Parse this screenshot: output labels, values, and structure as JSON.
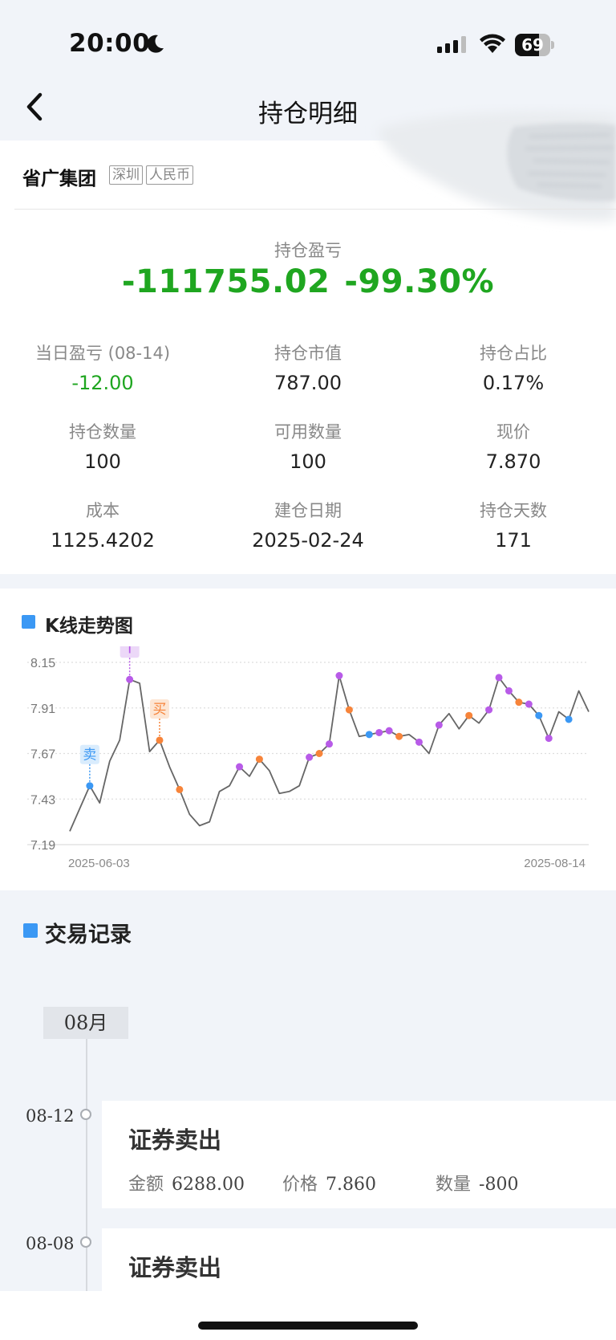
{
  "status_bar": {
    "time": "20:00",
    "battery_level": 69,
    "battery_text": "69",
    "icons": [
      "moon-icon",
      "cellular-signal-icon",
      "wifi-icon",
      "battery-icon"
    ]
  },
  "nav": {
    "title": "持仓明细",
    "back_icon": "chevron-left-icon"
  },
  "stock": {
    "name": "省广集团",
    "tags": [
      "深圳",
      "人民币"
    ]
  },
  "pnl": {
    "label": "持仓盈亏",
    "amount": "-111755.02",
    "percent": "-99.30%"
  },
  "stats": [
    {
      "label": "当日盈亏 (08-14)",
      "value": "-12.00"
    },
    {
      "label": "持仓市值",
      "value": "787.00"
    },
    {
      "label": "持仓占比",
      "value": "0.17%"
    },
    {
      "label": "持仓数量",
      "value": "100"
    },
    {
      "label": "可用数量",
      "value": "100"
    },
    {
      "label": "现价",
      "value": "7.870"
    },
    {
      "label": "成本",
      "value": "1125.4202"
    },
    {
      "label": "建仓日期",
      "value": "2025-02-24"
    },
    {
      "label": "持仓天数",
      "value": "171"
    }
  ],
  "colors": {
    "loss_green": "#1fa620",
    "accent_blue": "#3b98f4",
    "sell_marker": "#3b98f4",
    "buy_marker": "#f7843a",
    "t_marker": "#b85be8",
    "line": "#666666"
  },
  "chart": {
    "title": "K线走势图"
  },
  "chart_data": {
    "type": "line",
    "title": "K线走势图",
    "y_ticks": [
      "8.15",
      "7.91",
      "7.67",
      "7.43",
      "7.19"
    ],
    "ylim": [
      7.19,
      8.15
    ],
    "x_start_label": "2025-06-03",
    "x_end_label": "2025-08-14",
    "grid": true,
    "series": [
      {
        "values": [
          7.26,
          7.38,
          7.5,
          7.41,
          7.63,
          7.74,
          8.06,
          8.04,
          7.68,
          7.74,
          7.6,
          7.48,
          7.35,
          7.29,
          7.31,
          7.47,
          7.5,
          7.6,
          7.55,
          7.64,
          7.58,
          7.46,
          7.47,
          7.5,
          7.65,
          7.67,
          7.72,
          8.08,
          7.9,
          7.76,
          7.77,
          7.78,
          7.79,
          7.76,
          7.77,
          7.73,
          7.67,
          7.82,
          7.88,
          7.8,
          7.87,
          7.83,
          7.9,
          8.07,
          8.0,
          7.94,
          7.93,
          7.87,
          7.75,
          7.89,
          7.85,
          8.0,
          7.89
        ]
      }
    ],
    "markers": [
      {
        "index": 2,
        "type": "sell",
        "label": "卖"
      },
      {
        "index": 6,
        "type": "T",
        "label": "T"
      },
      {
        "index": 9,
        "type": "buy",
        "label": "买"
      },
      {
        "index": 11,
        "type": "buy"
      },
      {
        "index": 17,
        "type": "T"
      },
      {
        "index": 19,
        "type": "buy"
      },
      {
        "index": 24,
        "type": "T"
      },
      {
        "index": 25,
        "type": "buy"
      },
      {
        "index": 26,
        "type": "T"
      },
      {
        "index": 27,
        "type": "T"
      },
      {
        "index": 28,
        "type": "buy"
      },
      {
        "index": 30,
        "type": "sell"
      },
      {
        "index": 31,
        "type": "T"
      },
      {
        "index": 32,
        "type": "T"
      },
      {
        "index": 33,
        "type": "buy"
      },
      {
        "index": 35,
        "type": "T"
      },
      {
        "index": 37,
        "type": "T"
      },
      {
        "index": 40,
        "type": "buy"
      },
      {
        "index": 42,
        "type": "T"
      },
      {
        "index": 43,
        "type": "T"
      },
      {
        "index": 44,
        "type": "T"
      },
      {
        "index": 45,
        "type": "buy"
      },
      {
        "index": 46,
        "type": "T"
      },
      {
        "index": 47,
        "type": "sell"
      },
      {
        "index": 48,
        "type": "T"
      },
      {
        "index": 50,
        "type": "sell"
      }
    ]
  },
  "records": {
    "title": "交易记录",
    "month": "08月",
    "items": [
      {
        "date": "08-12",
        "title": "证券卖出",
        "amount_label": "金额",
        "amount": "6288.00",
        "price_label": "价格",
        "price": "7.860",
        "qty_label": "数量",
        "qty": "-800"
      },
      {
        "date": "08-08",
        "title": "证券卖出",
        "amount_label": "金额",
        "amount": "",
        "price_label": "价格",
        "price": "",
        "qty_label": "数量",
        "qty": ""
      }
    ]
  }
}
